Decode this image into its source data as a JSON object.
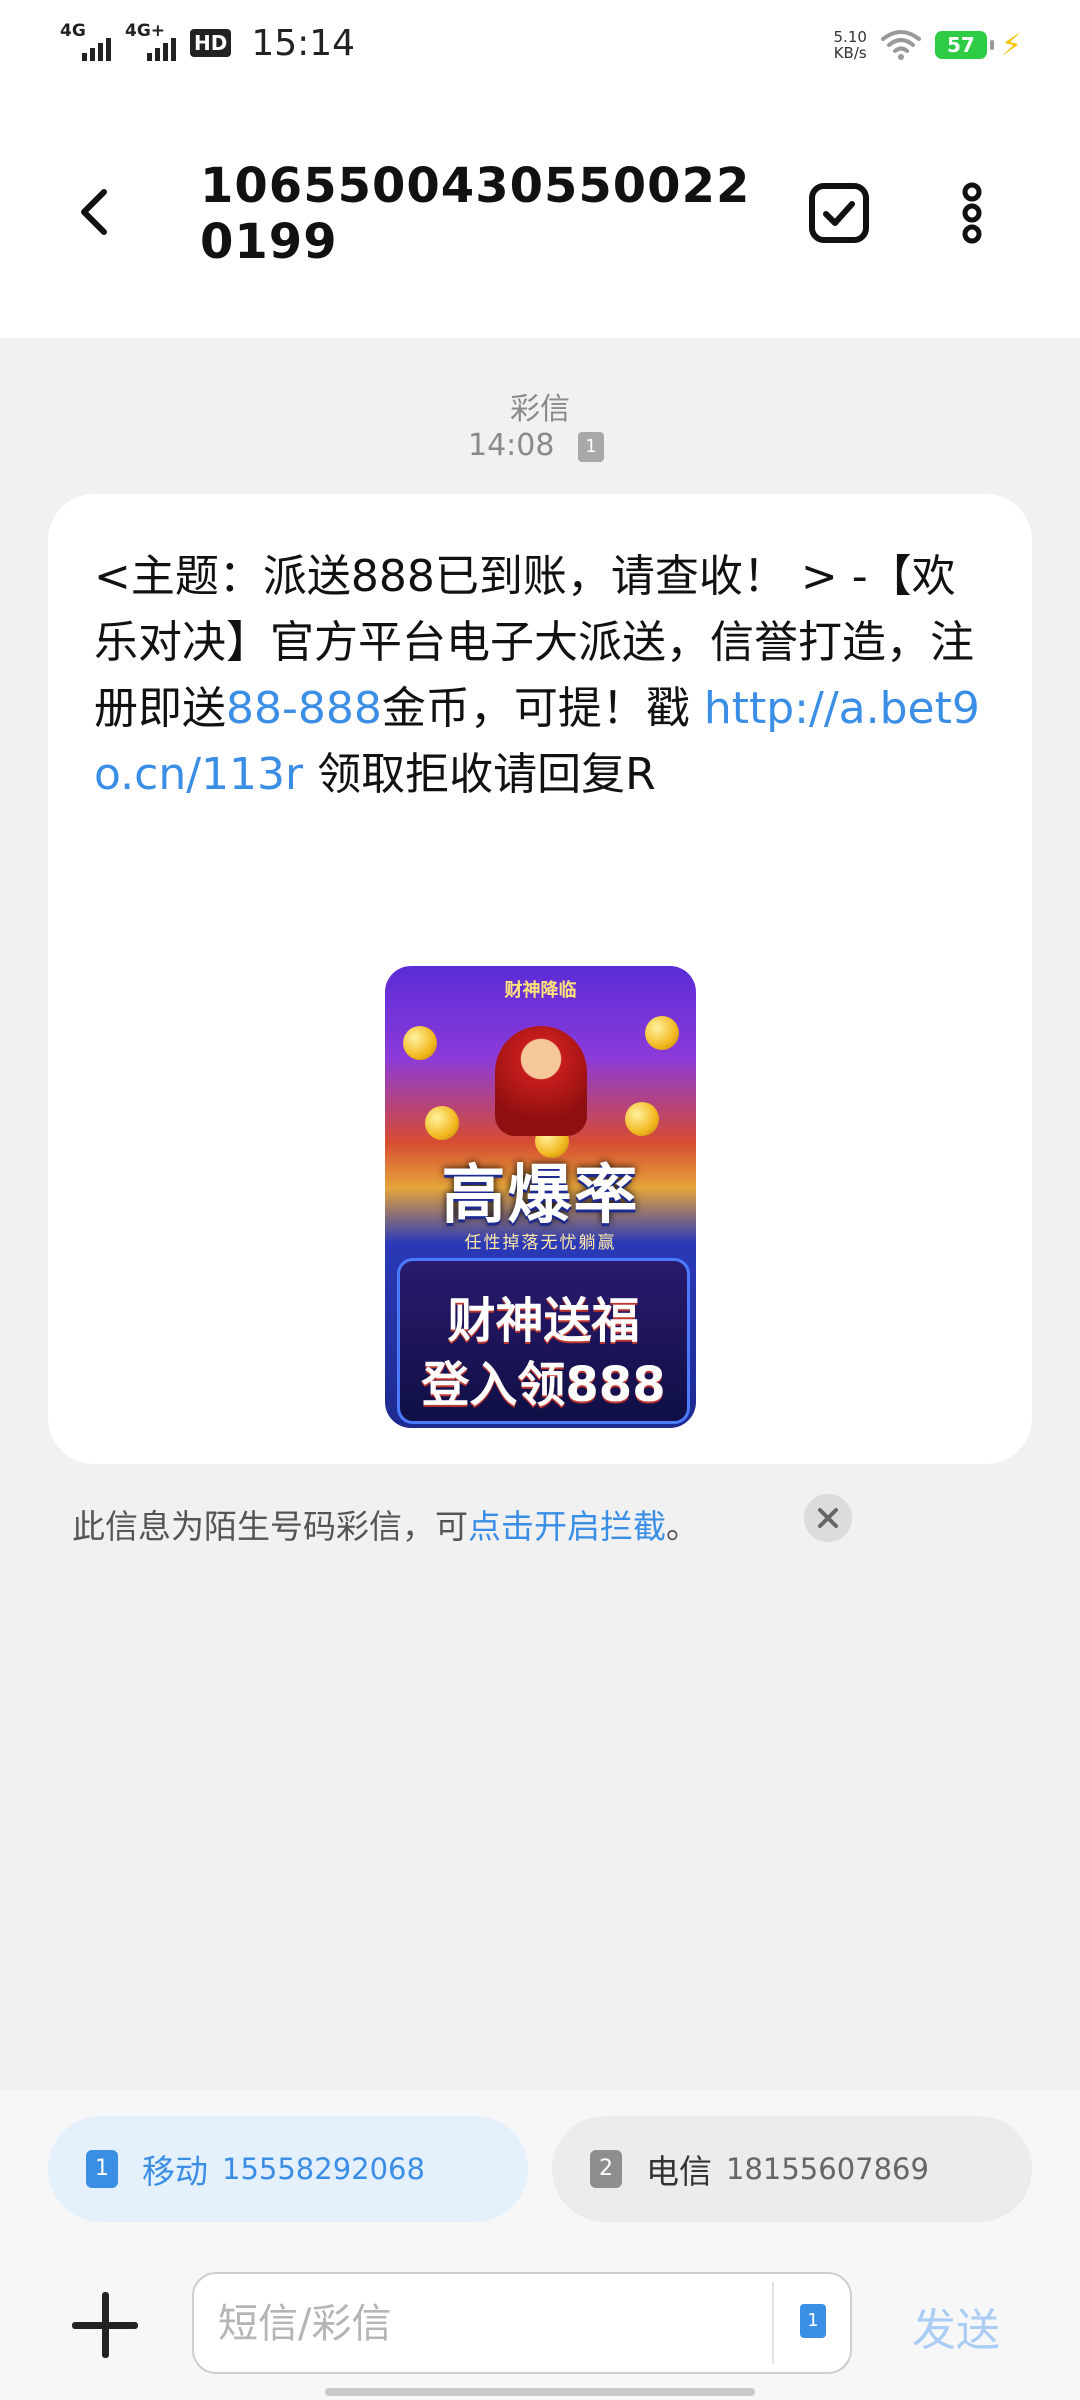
{
  "status_bar": {
    "signal1_net": "4G",
    "signal2_net": "4G+",
    "hd": "HD",
    "time": "15:14",
    "speed_value": "5.10",
    "speed_unit": "KB/s",
    "battery": "57"
  },
  "header": {
    "title": "10655004305500220199"
  },
  "thread": {
    "type_label": "彩信",
    "time": "14:08",
    "sim_badge": "1"
  },
  "message": {
    "text_part1": "<主题：派送888已到账，请查收！ > -【欢乐对决】官方平台电子大派送，信誉打造，注册即送",
    "highlight_amount": "88-888",
    "text_part2": "金币，可提！戳 ",
    "link": "http://a.bet9o.cn/113r",
    "text_part3": " 领取拒收请回复R"
  },
  "promo": {
    "top_text": "财神降临",
    "big_text": "高爆率",
    "sub_text": "任性掉落无忧躺赢",
    "line1": "财神送福",
    "line2": "登入领888"
  },
  "notice": {
    "text": "此信息为陌生号码彩信，可",
    "link_text": "点击开启拦截",
    "end": "。"
  },
  "sims": [
    {
      "badge": "1",
      "carrier": "移动",
      "number": "15558292068"
    },
    {
      "badge": "2",
      "carrier": "电信",
      "number": "18155607869"
    }
  ],
  "composer": {
    "placeholder": "短信/彩信",
    "sim_toggle": "1",
    "send_label": "发送"
  },
  "colors": {
    "accent": "#3a8ee6",
    "battery": "#2ecb45"
  }
}
